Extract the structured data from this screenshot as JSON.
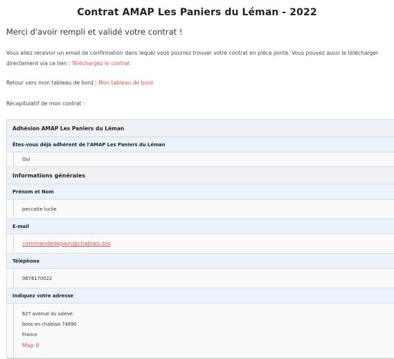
{
  "page": {
    "title": "Contrat AMAP Les Paniers du Léman - 2022",
    "thanks": "Merci d'avoir rempli et validé votre contrat !",
    "info_text": "Vous allez recevoir un email de confirmation dans lequel vous pourrez trouver votre contrat en pièce jointe. Vous pouvez aussi le télécharger",
    "info_text2": "directement via ce lien : ",
    "download_link": "Téléchargez le contrat",
    "back_text": "Retour vers mon tableau de bord : ",
    "dashboard_link": "Mon tableau de bord",
    "recap": "Récapitulatif de mon contrat :"
  },
  "summary": {
    "section1": "Adhésion AMAP Les Paniers du Léman",
    "q_member_label": "Êtes-vous déjà adhérent de l'AMAP Les Paniers du Léman",
    "q_member_value": "Oui",
    "section2": "Informations générales",
    "name_label": "Prénom et Nom",
    "name_value": "peccatte lucile",
    "email_label": "E-mail",
    "email_value": "commandedepain@chablais.bio",
    "phone_label": "Téléphone",
    "phone_value": "0678170022",
    "address_label": "Indiquez votre adresse",
    "address_line1": "627 avenue du saleve",
    "address_line2": "bons en chablais 74890",
    "address_line3": "France",
    "map_link": "Map It"
  },
  "colors": {
    "link": "#d9534f",
    "section_bg": "#eef1f5",
    "label_bg": "#eaf2fb"
  }
}
